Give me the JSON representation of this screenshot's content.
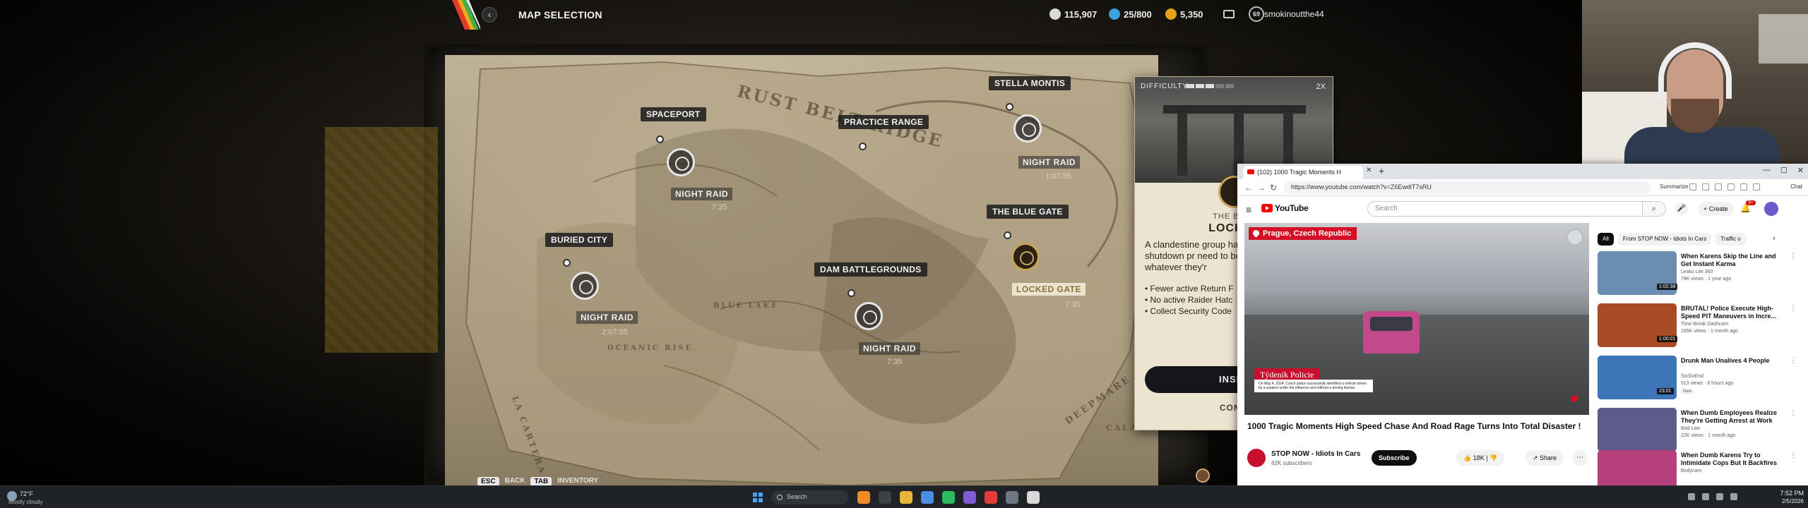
{
  "game": {
    "screen_title": "MAP SELECTION",
    "back_icon": "chevron-left-icon",
    "currencies": [
      {
        "value": "115,907",
        "icon": "coin-icon",
        "color": "#d9d9d9"
      },
      {
        "value": "25/800",
        "icon": "raider-token-icon",
        "color": "#3fa2e0"
      },
      {
        "value": "5,350",
        "icon": "cred-icon",
        "color": "#e3a11a"
      }
    ],
    "mail_icon": "inbox-icon",
    "level": "69",
    "username": "smokinoutthe44",
    "map_words": [
      "RUST BELT RIDGE",
      "LA CARTERA",
      "DEEPMARE",
      "BLUE LAKE",
      "OCEANIC RISE",
      "CALABR"
    ],
    "locations": [
      {
        "name": "SPACEPORT",
        "raid": "NIGHT RAID",
        "timer": "7:35"
      },
      {
        "name": "PRACTICE RANGE"
      },
      {
        "name": "STELLA MONTIS",
        "raid": "NIGHT RAID",
        "timer": "1:07:35"
      },
      {
        "name": "BURIED CITY",
        "raid": "NIGHT RAID",
        "timer": "2:07:35"
      },
      {
        "name": "DAM BATTLEGROUNDS",
        "raid": "NIGHT RAID",
        "timer": "7:35"
      },
      {
        "name": "THE BLUE GATE",
        "raid": "LOCKED GATE",
        "timer": "7:35"
      }
    ],
    "hint": {
      "key1": "ESC",
      "label1": "BACK",
      "key2": "TAB",
      "label2": "INVENTORY"
    }
  },
  "info_panel": {
    "difficulty_label": "DIFFICULTY",
    "difficulty_level": 0.6,
    "multiplier": "2X",
    "subtitle": "THE BLUE",
    "title": "LOCKED",
    "description": "A clandestine group has emergency shutdown pr need to be obtained to uncover whatever they'r",
    "bullets": [
      "Fewer active Return F",
      "No active Raider Hatc",
      "Collect Security Code"
    ],
    "inspect_button": "INSPE",
    "confirm_text": "CONFI"
  },
  "browser": {
    "tab_title": "(102) 1000 Tragic Moments H",
    "url": "https://www.youtube.com/watch?v=Z6EwdiT7sRU",
    "summarize": "Summarize",
    "chat": "Chat",
    "yt": {
      "brand": "YouTube",
      "search_placeholder": "Search",
      "create": "Create",
      "notif_count": "9+",
      "video": {
        "location_badge": "Prague, Czech Republic",
        "news_logo": "Týdeník Policie",
        "news_caption": "On May 4, 2024, Czech police successfully identified a vehicle driven by a suspect under the influence and without a driving license.",
        "title": "1000 Tragic Moments High Speed Chase And Road Rage Turns Into Total Disaster !",
        "channel": "STOP NOW - Idiots In Cars",
        "subscribers": "82K subscribers",
        "subscribe": "Subscribe",
        "likes": "18K",
        "share": "Share"
      },
      "chips": [
        "All",
        "From STOP NOW - Idiots In Cars",
        "Traffic o"
      ],
      "recommendations": [
        {
          "title": "When Karens Skip the Line and Get Instant Karma",
          "channel": "Leaks Lite 360",
          "meta": "78K views · 1 year ago",
          "duration": "1:02:38",
          "thumb": "#6b8db1"
        },
        {
          "title": "BRUTAL! Police Execute High-Speed PIT Maneuvers in Incre...",
          "channel": "Time Break Dashcam",
          "meta": "165K views · 1 month ago",
          "duration": "1:00:01",
          "thumb": "#a94b27"
        },
        {
          "title": "Drunk Man Unalives 4 People",
          "channel": "SixSixEnd",
          "meta": "513 views · 6 hours ago",
          "new": "New",
          "duration": "23:01",
          "thumb": "#3e74b8"
        },
        {
          "title": "When Dumb Employees Realize They're Getting Arrest at Work",
          "channel": "Bad Law",
          "meta": "22K views · 1 month ago",
          "duration": "",
          "thumb": "#5e5a8a"
        },
        {
          "title": "When Dumb Karens Try to Intimidate Cops But It Backfires",
          "channel": "Bodycam",
          "meta": "",
          "duration": "",
          "thumb": "#b6407c"
        }
      ]
    }
  },
  "taskbar": {
    "weather_temp": "72°F",
    "weather_desc": "Mostly cloudy",
    "search": "Search",
    "time": "7:52 PM",
    "date": "2/5/2026"
  },
  "colors": {
    "accent_gate": "#c9a35a",
    "youtube_red": "#ff0000",
    "taskbar": "#1f2226"
  }
}
